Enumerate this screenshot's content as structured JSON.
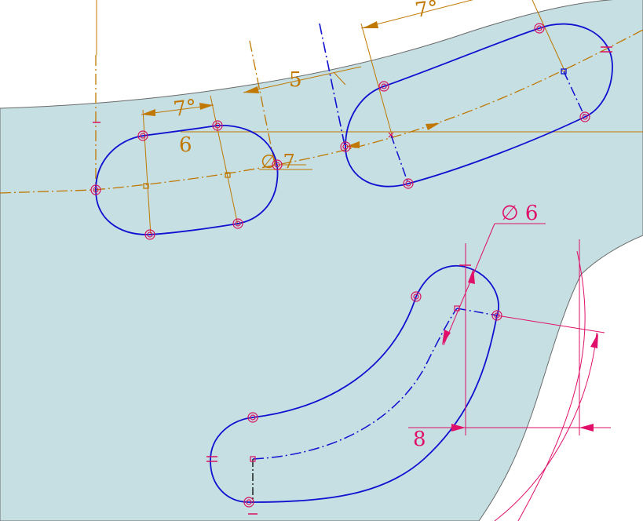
{
  "dimensions": {
    "angle_top_right": "7°",
    "angle_left": "7°",
    "length_5": "5",
    "length_6": "6",
    "diameter_7": "∅ 7",
    "diameter_6": "∅ 6",
    "length_8": "8"
  },
  "colors": {
    "part_face": "#c5dfe3",
    "part_edge": "#6a6a6a",
    "background": "#ffffff",
    "sketch_curve": "#1010d0",
    "dimension_orange": "#c07800",
    "dimension_magenta": "#e0106a",
    "constraint_marker": "#d81060"
  }
}
